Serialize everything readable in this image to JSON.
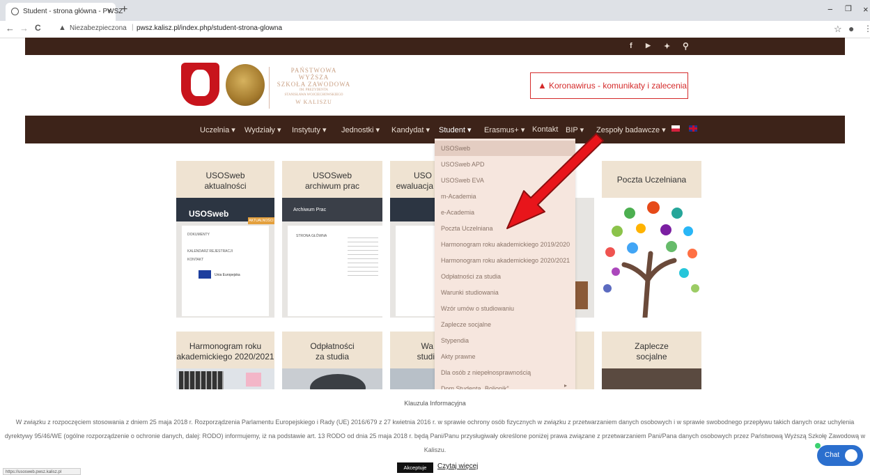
{
  "browser": {
    "tab_title": "Student - strona główna - PWSZ",
    "tab_close": "×",
    "new_tab": "+",
    "back": "←",
    "forward": "→",
    "reload": "C",
    "security_label": "Niezabezpieczona",
    "url": "pwsz.kalisz.pl/index.php/student-strona-glowna",
    "minimize": "−",
    "restore": "❐",
    "close": "×",
    "star": "☆",
    "profile": "●",
    "menu": "⋮"
  },
  "social": {
    "facebook": "f",
    "youtube": "▶",
    "twitter": "✦",
    "search": "⚲"
  },
  "header": {
    "logo_line1": "PAŃSTWOWA WYŻSZA",
    "logo_line2": "SZKOŁA ZAWODOWA",
    "logo_line3": "IM. PREZYDENTA",
    "logo_line4": "STANISŁAWA WOJCIECHOWSKIEGO",
    "logo_line5": "W KALISZU",
    "corona_label": "Koronawirus - komunikaty i zalecenia"
  },
  "nav": [
    {
      "label": "Uczelnia ▾"
    },
    {
      "label": "Wydziały ▾"
    },
    {
      "label": "Instytuty ▾"
    },
    {
      "label": "Jednostki ▾"
    },
    {
      "label": "Kandydat ▾"
    },
    {
      "label": "Student ▾"
    },
    {
      "label": "Erasmus+ ▾"
    },
    {
      "label": "Kontakt"
    },
    {
      "label": "BIP ▾"
    },
    {
      "label": "Zespoły badawcze ▾"
    }
  ],
  "tiles": [
    {
      "line1": "USOSweb",
      "line2": "aktualności"
    },
    {
      "line1": "USOSweb",
      "line2": "archiwum prac"
    },
    {
      "line1": "USO",
      "line2": "ewaluacja"
    },
    {
      "line1": "Poczta Uczelniana",
      "line2": ""
    },
    {
      "line1": "Harmonogram roku",
      "line2": "akademickiego 2020/2021"
    },
    {
      "line1": "Odpłatności",
      "line2": "za studia"
    },
    {
      "line1": "Wa",
      "line2": "studi"
    },
    {
      "line1": "Zaplecze",
      "line2": "socjalne"
    }
  ],
  "tile_shots": {
    "usos_logo": "USOSweb",
    "aktualnosci_tab": "AKTUALNOŚCI",
    "dokumenty": "DOKUMENTY",
    "kalendarz": "KALENDARZ REJESTRACJI",
    "kontakt": "KONTAKT",
    "ue": "Unia Europejska",
    "archiwum": "Archiwum Prac",
    "strona_glowna": "STRONA GŁÓWNA"
  },
  "dropdown": [
    "USOSweb",
    "USOSweb APD",
    "USOSweb EVA",
    "m-Academia",
    "e-Academia",
    "Poczta Uczelniana",
    "Harmonogram roku akademickiego 2019/2020",
    "Harmonogram roku akademickiego 2020/2021",
    "Odpłatności za studia",
    "Warunki studiowania",
    "Wzór umów o studiowaniu",
    "Zaplecze socjalne",
    "Stypendia",
    "Akty prawne",
    "Dla osób z niepełnosprawnością",
    "Dom Studenta „Bolionik”"
  ],
  "cookie": {
    "heading": "Klauzula Informacyjna",
    "text": "W związku z rozpoczęciem stosowania z dniem 25 maja 2018 r. Rozporządzenia Parlamentu Europejskiego i Rady (UE) 2016/679 z 27 kwietnia 2016 r. w sprawie ochrony osób fizycznych w związku z przetwarzaniem danych osobowych i w sprawie swobodnego przepływu takich danych oraz uchylenia dyrektywy 95/46/WE (ogólne rozporządzenie o ochronie danych, dalej: RODO) informujemy, iż na podstawie art. 13 RODO od dnia 25 maja 2018 r. będą Pani/Panu przysługiwały określone poniżej prawa związane z przetwarzaniem Pani/Pana danych osobowych przez Państwową Wyższą Szkołę Zawodową w Kaliszu.",
    "accept": "Akceptuje",
    "read_more": "Czytaj więcej"
  },
  "status_url": "https://usosweb.pwsz.kalisz.pl",
  "chat_label": "Chat",
  "colors": {
    "brand_brown": "#3d2319",
    "tile_beige": "#efe3d2",
    "dropdown_bg": "#f6e6de",
    "alert_red": "#d42a2a",
    "arrow_red": "#e8151b",
    "chat_blue": "#2b6fce"
  }
}
